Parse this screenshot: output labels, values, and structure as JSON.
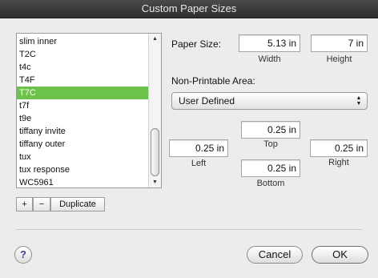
{
  "window": {
    "title": "Custom Paper Sizes"
  },
  "list": {
    "items": [
      "slim inner",
      "T2C",
      "t4c",
      "T4F",
      "T7C",
      "t7f",
      "t9e",
      "tiffany invite",
      "tiffany outer",
      "tux",
      "tux response",
      "WC5961"
    ],
    "selected_index": 4
  },
  "list_buttons": {
    "add": "+",
    "remove": "−",
    "duplicate": "Duplicate"
  },
  "paper_size": {
    "label": "Paper Size:",
    "width": "5.13 in",
    "height": "7 in",
    "width_caption": "Width",
    "height_caption": "Height"
  },
  "non_printable": {
    "label": "Non-Printable Area:",
    "selected": "User Defined",
    "top": "0.25 in",
    "left": "0.25 in",
    "right": "0.25 in",
    "bottom": "0.25 in",
    "top_caption": "Top",
    "left_caption": "Left",
    "right_caption": "Right",
    "bottom_caption": "Bottom"
  },
  "footer": {
    "help": "?",
    "cancel": "Cancel",
    "ok": "OK"
  },
  "colors": {
    "selection": "#6cc24a",
    "titlebar": "#3a3a3a"
  }
}
